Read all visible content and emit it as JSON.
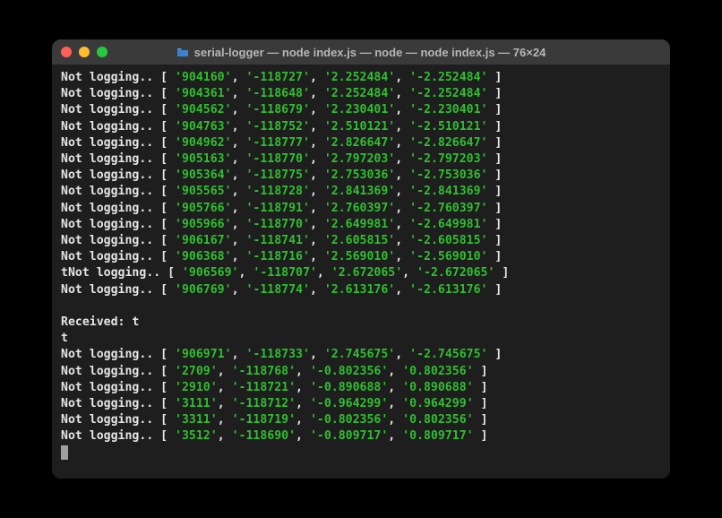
{
  "window": {
    "title": "serial-logger — node index.js — node — node index.js — 76×24"
  },
  "prefix": "Not logging..",
  "prefix_t": "tNot logging..",
  "received_line": "Received: t",
  "t_line": "t",
  "rows": [
    {
      "prefix": "Not logging..",
      "vals": [
        "904160",
        "-118727",
        "2.252484",
        "-2.252484"
      ]
    },
    {
      "prefix": "Not logging..",
      "vals": [
        "904361",
        "-118648",
        "2.252484",
        "-2.252484"
      ]
    },
    {
      "prefix": "Not logging..",
      "vals": [
        "904562",
        "-118679",
        "2.230401",
        "-2.230401"
      ]
    },
    {
      "prefix": "Not logging..",
      "vals": [
        "904763",
        "-118752",
        "2.510121",
        "-2.510121"
      ]
    },
    {
      "prefix": "Not logging..",
      "vals": [
        "904962",
        "-118777",
        "2.826647",
        "-2.826647"
      ]
    },
    {
      "prefix": "Not logging..",
      "vals": [
        "905163",
        "-118770",
        "2.797203",
        "-2.797203"
      ]
    },
    {
      "prefix": "Not logging..",
      "vals": [
        "905364",
        "-118775",
        "2.753036",
        "-2.753036"
      ]
    },
    {
      "prefix": "Not logging..",
      "vals": [
        "905565",
        "-118728",
        "2.841369",
        "-2.841369"
      ]
    },
    {
      "prefix": "Not logging..",
      "vals": [
        "905766",
        "-118791",
        "2.760397",
        "-2.760397"
      ]
    },
    {
      "prefix": "Not logging..",
      "vals": [
        "905966",
        "-118770",
        "2.649981",
        "-2.649981"
      ]
    },
    {
      "prefix": "Not logging..",
      "vals": [
        "906167",
        "-118741",
        "2.605815",
        "-2.605815"
      ]
    },
    {
      "prefix": "Not logging..",
      "vals": [
        "906368",
        "-118716",
        "2.569010",
        "-2.569010"
      ]
    },
    {
      "prefix": "tNot logging..",
      "vals": [
        "906569",
        "-118707",
        "2.672065",
        "-2.672065"
      ]
    },
    {
      "prefix": "Not logging..",
      "vals": [
        "906769",
        "-118774",
        "2.613176",
        "-2.613176"
      ]
    }
  ],
  "rows2": [
    {
      "prefix": "Not logging..",
      "vals": [
        "906971",
        "-118733",
        "2.745675",
        "-2.745675"
      ]
    },
    {
      "prefix": "Not logging..",
      "vals": [
        "2709",
        "-118768",
        "-0.802356",
        "0.802356"
      ]
    },
    {
      "prefix": "Not logging..",
      "vals": [
        "2910",
        "-118721",
        "-0.890688",
        "0.890688"
      ]
    },
    {
      "prefix": "Not logging..",
      "vals": [
        "3111",
        "-118712",
        "-0.964299",
        "0.964299"
      ]
    },
    {
      "prefix": "Not logging..",
      "vals": [
        "3311",
        "-118719",
        "-0.802356",
        "0.802356"
      ]
    },
    {
      "prefix": "Not logging..",
      "vals": [
        "3512",
        "-118690",
        "-0.809717",
        "0.809717"
      ]
    }
  ]
}
